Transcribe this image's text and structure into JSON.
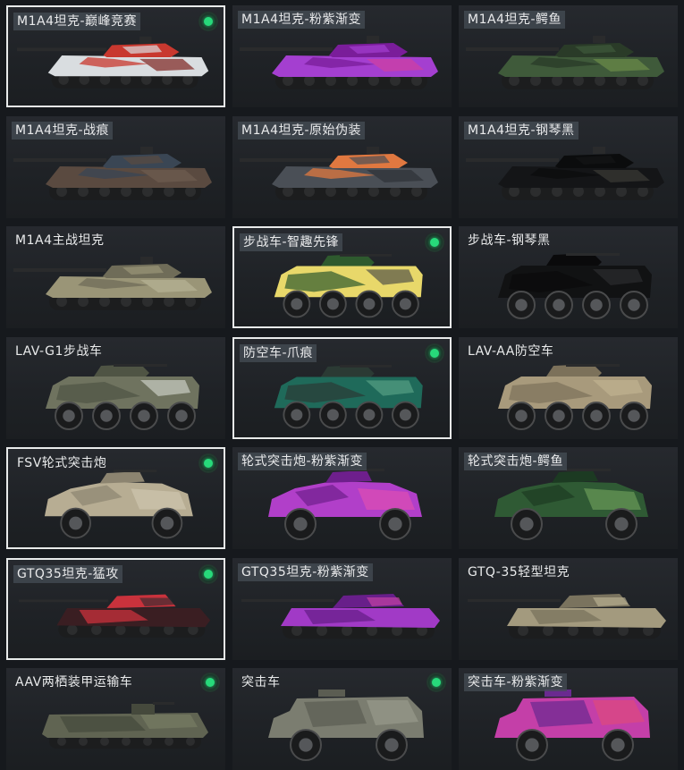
{
  "skins": [
    {
      "name": "M1A4坦克-巅峰竞赛",
      "tagged": true,
      "selected": true,
      "owned": true,
      "kind": "tank",
      "colors": [
        "#d9dde0",
        "#c8382f",
        "#7d2420"
      ]
    },
    {
      "name": "M1A4坦克-粉紫渐变",
      "tagged": true,
      "selected": false,
      "owned": false,
      "kind": "tank",
      "colors": [
        "#a43fd0",
        "#7a1d9a",
        "#d040a0"
      ]
    },
    {
      "name": "M1A4坦克-鳄鱼",
      "tagged": true,
      "selected": false,
      "owned": false,
      "kind": "tank",
      "colors": [
        "#3f5a3a",
        "#2a3b28",
        "#6c8c48"
      ]
    },
    {
      "name": "M1A4坦克-战痕",
      "tagged": true,
      "selected": false,
      "owned": false,
      "kind": "tank",
      "colors": [
        "#5a4a40",
        "#3a4654",
        "#6e5c50"
      ]
    },
    {
      "name": "M1A4坦克-原始伪装",
      "tagged": true,
      "selected": false,
      "owned": false,
      "kind": "tank",
      "colors": [
        "#4a4f56",
        "#e07840",
        "#2e3238"
      ]
    },
    {
      "name": "M1A4坦克-钢琴黑",
      "tagged": true,
      "selected": false,
      "owned": false,
      "kind": "tank",
      "colors": [
        "#141517",
        "#0b0c0d",
        "#3a3a36"
      ]
    },
    {
      "name": "M1A4主战坦克",
      "tagged": false,
      "selected": false,
      "owned": false,
      "kind": "tank",
      "colors": [
        "#9a9577",
        "#6f6c58",
        "#b7b396"
      ]
    },
    {
      "name": "步战车-智趣先锋",
      "tagged": true,
      "selected": true,
      "owned": true,
      "kind": "ifv",
      "colors": [
        "#e8d86a",
        "#2e5a2e",
        "#3a3d42"
      ]
    },
    {
      "name": "步战车-钢琴黑",
      "tagged": false,
      "selected": false,
      "owned": false,
      "kind": "ifv",
      "colors": [
        "#111213",
        "#0a0a0b",
        "#303033"
      ]
    },
    {
      "name": "LAV-G1步战车",
      "tagged": false,
      "selected": false,
      "owned": false,
      "kind": "ifv",
      "colors": [
        "#6f735f",
        "#4f5444",
        "#d8dcd4"
      ]
    },
    {
      "name": "防空车-爪痕",
      "tagged": true,
      "selected": true,
      "owned": true,
      "kind": "ifv",
      "colors": [
        "#1f6a5a",
        "#2b3a34",
        "#5fa88a"
      ]
    },
    {
      "name": "LAV-AA防空车",
      "tagged": false,
      "selected": false,
      "owned": false,
      "kind": "ifv",
      "colors": [
        "#a89a7c",
        "#7c715a",
        "#c4b794"
      ]
    },
    {
      "name": "FSV轮式突击炮",
      "tagged": false,
      "selected": true,
      "owned": true,
      "kind": "armored",
      "colors": [
        "#b7ad93",
        "#8c8470",
        "#d0c8b0"
      ]
    },
    {
      "name": "轮式突击炮-粉紫渐变",
      "tagged": true,
      "selected": false,
      "owned": false,
      "kind": "armored",
      "colors": [
        "#b13fc9",
        "#6e1f8c",
        "#e24fb0"
      ]
    },
    {
      "name": "轮式突击炮-鳄鱼",
      "tagged": true,
      "selected": false,
      "owned": false,
      "kind": "armored",
      "colors": [
        "#2f5a34",
        "#1c3a22",
        "#6ea05a"
      ]
    },
    {
      "name": "GTQ35坦克-猛攻",
      "tagged": true,
      "selected": true,
      "owned": true,
      "kind": "light",
      "colors": [
        "#3a1e22",
        "#c9323c",
        "#2a2a2e"
      ]
    },
    {
      "name": "GTQ35坦克-粉紫渐变",
      "tagged": true,
      "selected": false,
      "owned": false,
      "kind": "light",
      "colors": [
        "#a13ac6",
        "#681f8a",
        "#d448a8"
      ]
    },
    {
      "name": "GTQ-35轻型坦克",
      "tagged": false,
      "selected": false,
      "owned": false,
      "kind": "light",
      "colors": [
        "#a39a7e",
        "#7a735e",
        "#c2b99a"
      ]
    },
    {
      "name": "AAV两栖装甲运输车",
      "tagged": false,
      "selected": false,
      "owned": true,
      "kind": "aav",
      "colors": [
        "#606452",
        "#45493c",
        "#7c8068"
      ]
    },
    {
      "name": "突击车",
      "tagged": false,
      "selected": false,
      "owned": true,
      "kind": "truck",
      "colors": [
        "#7b7d70",
        "#5b5d52",
        "#9a9c8e"
      ]
    },
    {
      "name": "突击车-粉紫渐变",
      "tagged": true,
      "selected": false,
      "owned": false,
      "kind": "truck",
      "colors": [
        "#c43fa8",
        "#6a2a90",
        "#e14a7a"
      ]
    }
  ]
}
